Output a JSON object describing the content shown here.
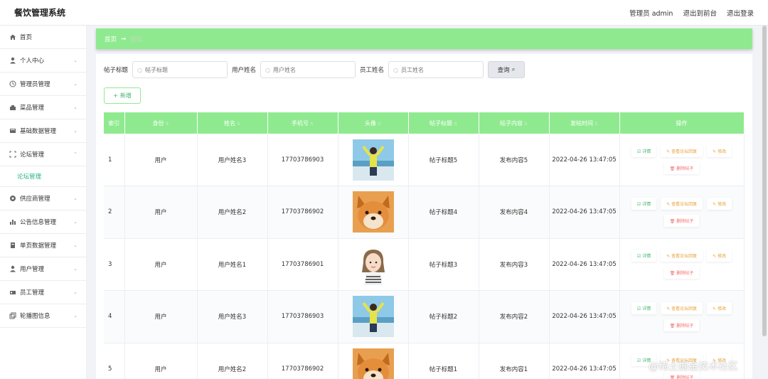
{
  "header": {
    "title": "餐饮管理系统",
    "admin": "管理员 admin",
    "to_front": "退出到前台",
    "logout": "退出登录"
  },
  "sidebar": {
    "items": [
      {
        "label": "首页",
        "icon": "home-icon"
      },
      {
        "label": "个人中心",
        "icon": "user-icon"
      },
      {
        "label": "管理员管理",
        "icon": "clock-icon"
      },
      {
        "label": "菜品管理",
        "icon": "dish-icon"
      },
      {
        "label": "基础数据管理",
        "icon": "data-icon"
      },
      {
        "label": "论坛管理",
        "icon": "forum-icon"
      },
      {
        "label": "论坛管理",
        "icon": ""
      },
      {
        "label": "供应商管理",
        "icon": "supplier-icon"
      },
      {
        "label": "公告信息管理",
        "icon": "chart-icon"
      },
      {
        "label": "单页数据管理",
        "icon": "page-icon"
      },
      {
        "label": "用户管理",
        "icon": "user-icon"
      },
      {
        "label": "员工管理",
        "icon": "staff-icon"
      },
      {
        "label": "轮播图信息",
        "icon": "carousel-icon"
      }
    ]
  },
  "breadcrumb": {
    "home": "首页",
    "current": "论坛"
  },
  "search": {
    "title_label": "帖子标题",
    "title_placeholder": "帖子标题",
    "user_label": "用户姓名",
    "user_placeholder": "用户姓名",
    "staff_label": "员工姓名",
    "staff_placeholder": "员工姓名",
    "query": "查询"
  },
  "add_button": "新增",
  "table": {
    "columns": [
      "索引",
      "身份",
      "姓名",
      "手机号",
      "头像",
      "帖子标题",
      "帖子内容",
      "发帖时间",
      "操作"
    ],
    "rows": [
      {
        "idx": "1",
        "role": "用户",
        "name": "用户姓名3",
        "phone": "17703786903",
        "avatar": "girl-beach",
        "title": "帖子标题5",
        "content": "发布内容5",
        "time": "2022-04-26 13:47:05"
      },
      {
        "idx": "2",
        "role": "用户",
        "name": "用户姓名2",
        "phone": "17703786902",
        "avatar": "shiba-dog",
        "title": "帖子标题4",
        "content": "发布内容4",
        "time": "2022-04-26 13:47:05"
      },
      {
        "idx": "3",
        "role": "用户",
        "name": "用户姓名1",
        "phone": "17703786901",
        "avatar": "cartoon-girl",
        "title": "帖子标题3",
        "content": "发布内容3",
        "time": "2022-04-26 13:47:05"
      },
      {
        "idx": "4",
        "role": "用户",
        "name": "用户姓名3",
        "phone": "17703786903",
        "avatar": "girl-beach",
        "title": "帖子标题2",
        "content": "发布内容2",
        "time": "2022-04-26 13:47:05"
      },
      {
        "idx": "5",
        "role": "用户",
        "name": "用户姓名2",
        "phone": "17703786902",
        "avatar": "shiba-dog",
        "title": "帖子标题1",
        "content": "发布内容1",
        "time": "2022-04-26 13:47:05"
      }
    ],
    "ops": {
      "view": "详情",
      "reply": "查看论坛回复",
      "edit": "修改",
      "delete": "删除帖子"
    }
  },
  "watermark": "@稀土掘金技术社区",
  "colors": {
    "accent": "#8fea8f",
    "teal": "#26b38a",
    "warn": "#e6a23c",
    "danger": "#f56c6c"
  }
}
